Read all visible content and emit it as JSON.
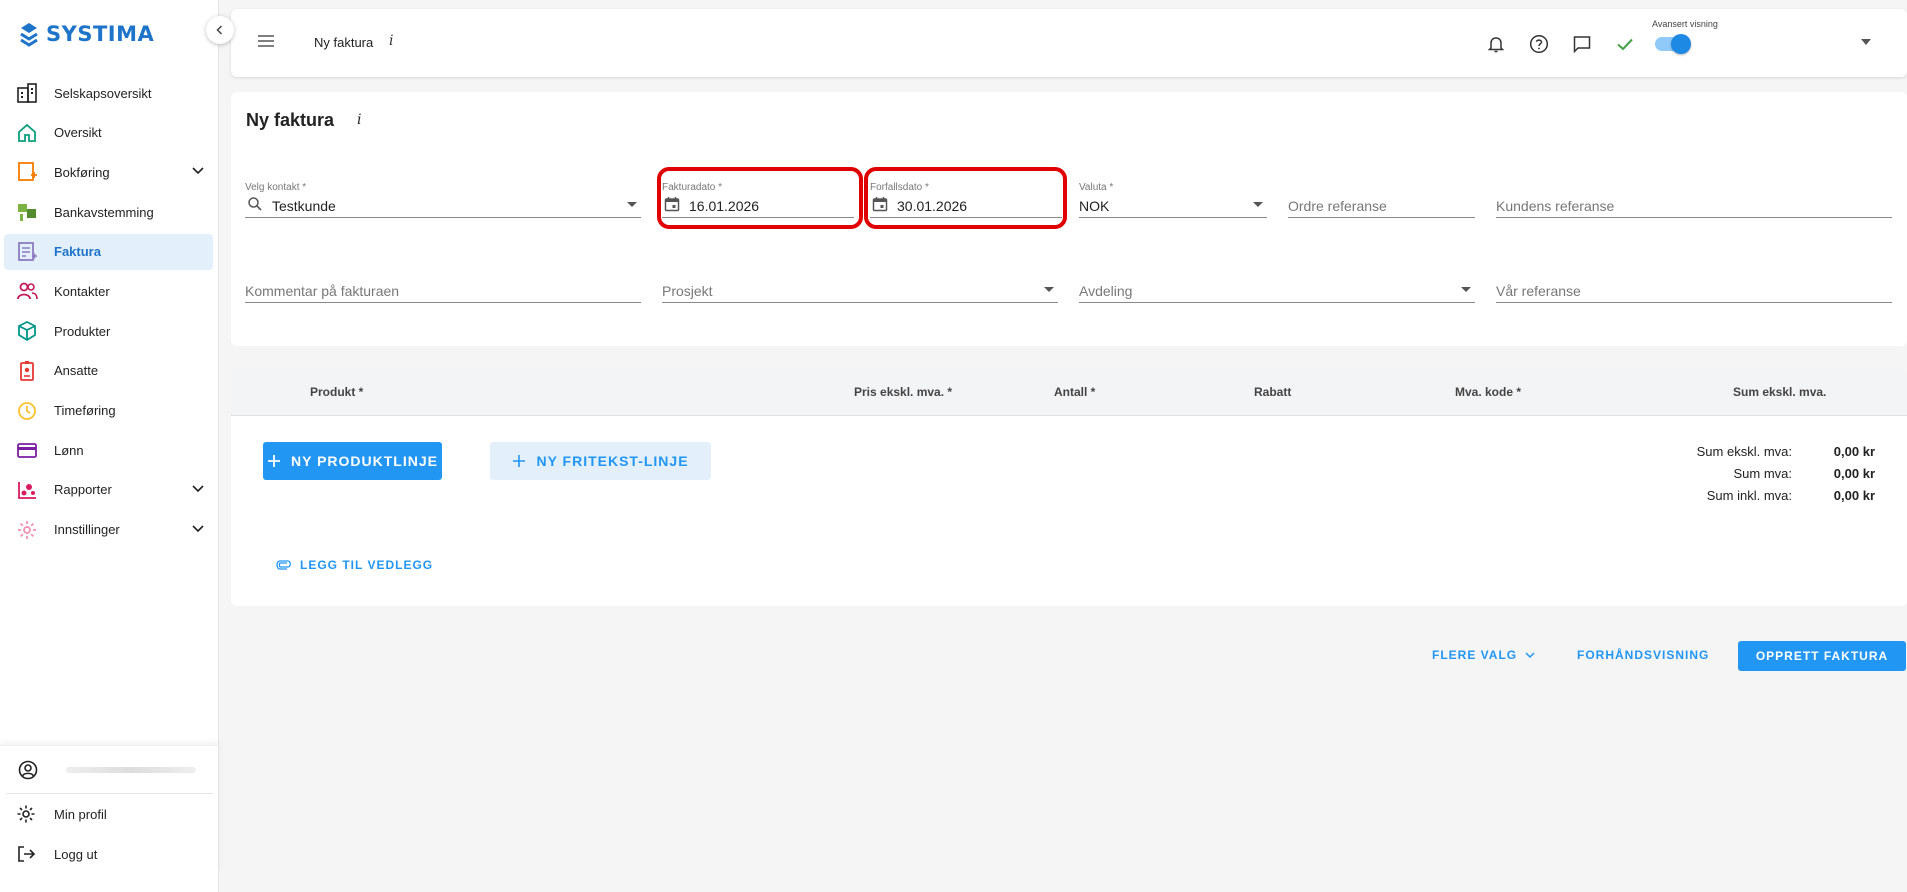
{
  "brand": {
    "name": "SYSTIMA",
    "color": "#1d74c9"
  },
  "sidebar": {
    "items": [
      {
        "label": "Selskapsoversikt",
        "icon": "building-icon"
      },
      {
        "label": "Oversikt",
        "icon": "home-icon"
      },
      {
        "label": "Bokføring",
        "icon": "ledger-plus-icon",
        "expandable": true
      },
      {
        "label": "Bankavstemming",
        "icon": "bank-reconcile-icon"
      },
      {
        "label": "Faktura",
        "icon": "invoice-icon",
        "active": true
      },
      {
        "label": "Kontakter",
        "icon": "contacts-icon"
      },
      {
        "label": "Produkter",
        "icon": "cube-icon"
      },
      {
        "label": "Ansatte",
        "icon": "badge-icon"
      },
      {
        "label": "Timeføring",
        "icon": "clock-icon"
      },
      {
        "label": "Lønn",
        "icon": "card-icon"
      },
      {
        "label": "Rapporter",
        "icon": "report-icon",
        "expandable": true
      },
      {
        "label": "Innstillinger",
        "icon": "gear-icon",
        "expandable": true
      }
    ],
    "bottom": {
      "profile_label": "Min profil",
      "logout_label": "Logg ut"
    }
  },
  "topbar": {
    "title": "Ny faktura",
    "info": "i",
    "advanced_label": "Avansert visning",
    "advanced_on": true,
    "success_color": "#43a047"
  },
  "form": {
    "title": "Ny faktura",
    "info": "i",
    "contact": {
      "label": "Velg kontakt *",
      "value": "Testkunde"
    },
    "invoice_date": {
      "label": "Fakturadato *",
      "value": "16.01.2026"
    },
    "due_date": {
      "label": "Forfallsdato *",
      "value": "30.01.2026"
    },
    "currency": {
      "label": "Valuta *",
      "value": "NOK"
    },
    "order_ref": {
      "placeholder": "Ordre referanse"
    },
    "customer_ref": {
      "placeholder": "Kundens referanse"
    },
    "comment": {
      "placeholder": "Kommentar på fakturaen"
    },
    "project": {
      "placeholder": "Prosjekt"
    },
    "department": {
      "placeholder": "Avdeling"
    },
    "our_ref": {
      "placeholder": "Vår referanse"
    },
    "highlight_color": "#e00000"
  },
  "lines": {
    "columns": [
      "Produkt *",
      "Pris ekskl. mva. *",
      "Antall *",
      "Rabatt",
      "Mva. kode *",
      "Sum ekskl. mva."
    ],
    "new_product_line": "NY PRODUKTLINJE",
    "new_text_line": "NY FRITEKST-LINJE",
    "add_attachment": "LEGG TIL VEDLEGG",
    "totals": [
      {
        "label": "Sum ekskl. mva:",
        "value": "0,00 kr"
      },
      {
        "label": "Sum mva:",
        "value": "0,00 kr"
      },
      {
        "label": "Sum inkl. mva:",
        "value": "0,00 kr"
      }
    ]
  },
  "footer": {
    "more_options": "FLERE VALG",
    "preview": "FORHÅNDSVISNING",
    "create": "OPPRETT FAKTURA",
    "accent": "#2196f3"
  }
}
